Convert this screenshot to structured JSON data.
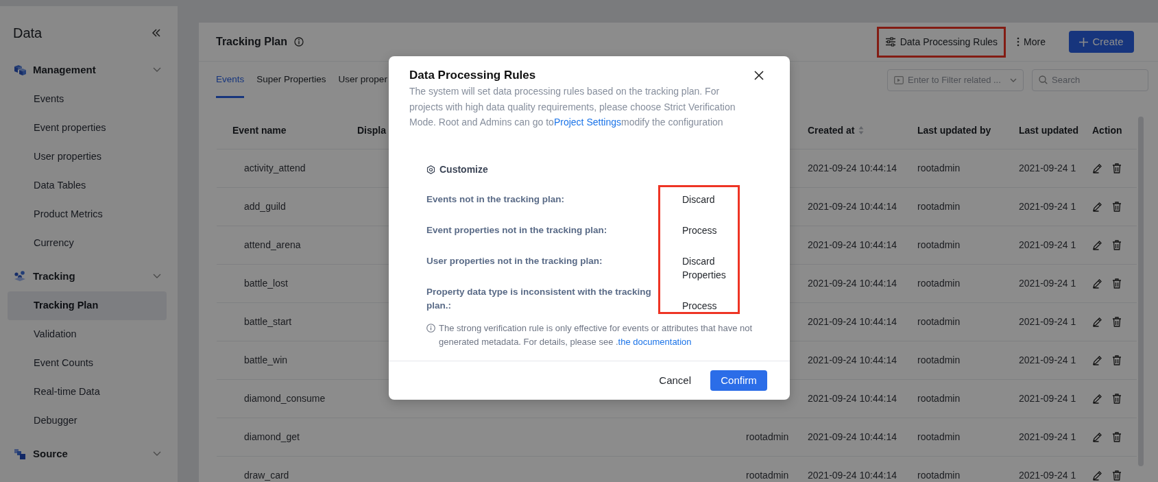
{
  "sidebar": {
    "title": "Data",
    "groups": [
      {
        "label": "Management",
        "expanded": true,
        "items": [
          {
            "label": "Events",
            "selected": false
          },
          {
            "label": "Event properties",
            "selected": false
          },
          {
            "label": "User properties",
            "selected": false
          },
          {
            "label": "Data Tables",
            "selected": false
          },
          {
            "label": "Product Metrics",
            "selected": false
          },
          {
            "label": "Currency",
            "selected": false
          }
        ]
      },
      {
        "label": "Tracking",
        "expanded": true,
        "items": [
          {
            "label": "Tracking Plan",
            "selected": true
          },
          {
            "label": "Validation",
            "selected": false
          },
          {
            "label": "Event Counts",
            "selected": false
          },
          {
            "label": "Real-time Data",
            "selected": false
          },
          {
            "label": "Debugger",
            "selected": false
          }
        ]
      },
      {
        "label": "Source",
        "expanded": true
      }
    ]
  },
  "header": {
    "title": "Tracking Plan",
    "actions": [
      {
        "kind": "rules",
        "label": "Data Processing Rules",
        "highlighted": true
      },
      {
        "kind": "more",
        "label": "More",
        "highlighted": false
      },
      {
        "kind": "create",
        "label": "Create",
        "highlighted": false
      }
    ]
  },
  "tabs": [
    {
      "label": "Events",
      "selected": true
    },
    {
      "label": "Super Properties",
      "selected": false
    },
    {
      "label": "User proper",
      "selected": false
    }
  ],
  "filter": {
    "placeholder": "Enter to Filter related ..."
  },
  "search": {
    "placeholder": "Search"
  },
  "table": {
    "columns": [
      {
        "kind": "text",
        "label": "Event name"
      },
      {
        "kind": "text",
        "label": "Displa"
      },
      {
        "kind": "text"
      },
      {
        "kind": "sortable",
        "label": "Created at"
      },
      {
        "kind": "text",
        "label": "Last updated by"
      },
      {
        "kind": "text",
        "label": "Last updated"
      },
      {
        "kind": "text",
        "label": "Action"
      }
    ],
    "rows": [
      {
        "cells": [
          "activity_attend",
          null,
          null,
          "2021-09-24 10:44:14",
          "rootadmin",
          "2021-09-24 1"
        ]
      },
      {
        "cells": [
          "add_guild",
          null,
          null,
          "2021-09-24 10:44:14",
          "rootadmin",
          "2021-09-24 1"
        ]
      },
      {
        "cells": [
          "attend_arena",
          null,
          null,
          "2021-09-24 10:44:14",
          "rootadmin",
          "2021-09-24 1"
        ]
      },
      {
        "cells": [
          "battle_lost",
          null,
          null,
          "2021-09-24 10:44:14",
          "rootadmin",
          "2021-09-24 1"
        ]
      },
      {
        "cells": [
          "battle_start",
          null,
          null,
          "2021-09-24 10:44:14",
          "rootadmin",
          "2021-09-24 1"
        ]
      },
      {
        "cells": [
          "battle_win",
          null,
          null,
          "2021-09-24 10:44:14",
          "rootadmin",
          "2021-09-24 1"
        ]
      },
      {
        "cells": [
          "diamond_consume",
          null,
          null,
          "2021-09-24 10:44:14",
          "rootadmin",
          "2021-09-24 1"
        ]
      },
      {
        "cells": [
          "diamond_get",
          null,
          "rootadmin",
          "2021-09-24 10:44:14",
          "rootadmin",
          "2021-09-24 1"
        ]
      },
      {
        "cells": [
          "draw_card",
          null,
          "rootadmin",
          "2021-09-24 10:44:14",
          "rootadmin",
          "2021-09-24 1"
        ]
      }
    ]
  },
  "modal": {
    "title": "Data Processing Rules",
    "description": {
      "text_before": "The system will set data processing rules based on the tracking plan. For projects with high data quality requirements, please choose Strict Verification Mode. Root and Admins can go to",
      "link": "Project Settings",
      "text_after": "modify the configuration"
    },
    "mode": "Customize",
    "rules_highlighted": true,
    "rules": [
      {
        "label": "Events not in the tracking plan:",
        "value": "Discard"
      },
      {
        "label": "Event properties not in the tracking plan:",
        "value": "Process"
      },
      {
        "label": "User properties not in the tracking plan:",
        "value": "Discard Properties"
      },
      {
        "label": "Property data type is inconsistent with the tracking plan.:",
        "value": "Process"
      }
    ],
    "note": {
      "text": "The strong verification rule is only effective for events or attributes that have not generated metadata. For details, please see .",
      "link": "the documentation"
    },
    "buttons": [
      {
        "kind": "secondary",
        "label": "Cancel"
      },
      {
        "kind": "primary",
        "label": "Confirm"
      }
    ]
  }
}
